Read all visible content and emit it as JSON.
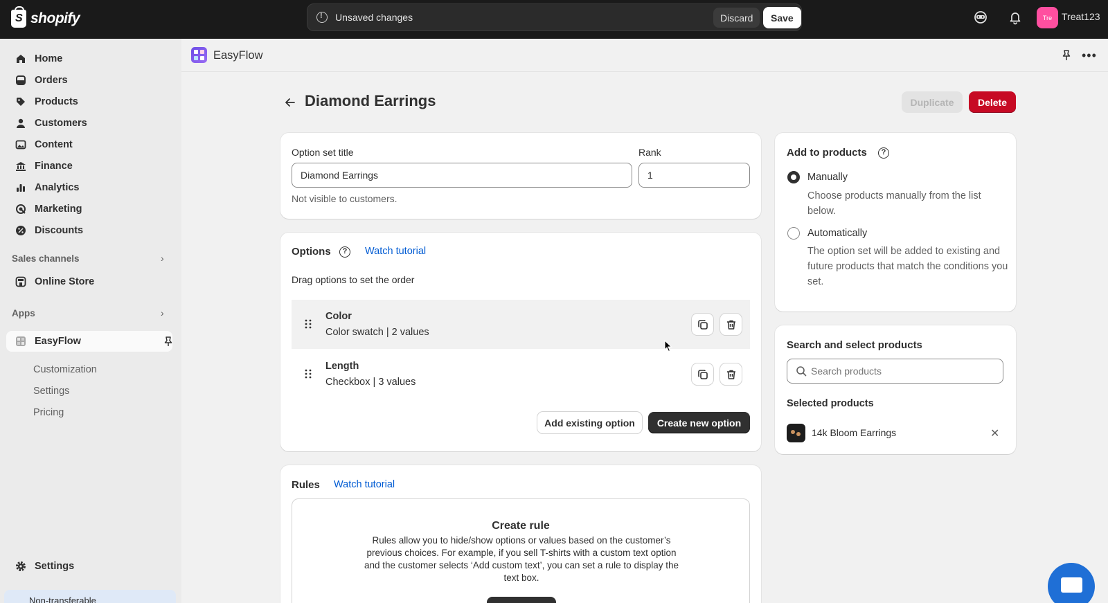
{
  "topbar": {
    "logo_text": "shopify",
    "unsaved_text": "Unsaved changes",
    "discard_label": "Discard",
    "save_label": "Save",
    "avatar_initials": "Tre",
    "store_name": "Treat123"
  },
  "sidebar": {
    "items": [
      {
        "label": "Home",
        "icon": "home-icon"
      },
      {
        "label": "Orders",
        "icon": "orders-icon"
      },
      {
        "label": "Products",
        "icon": "tag-icon"
      },
      {
        "label": "Customers",
        "icon": "person-icon"
      },
      {
        "label": "Content",
        "icon": "image-icon"
      },
      {
        "label": "Finance",
        "icon": "bank-icon"
      },
      {
        "label": "Analytics",
        "icon": "bar-chart-icon"
      },
      {
        "label": "Marketing",
        "icon": "target-icon"
      },
      {
        "label": "Discounts",
        "icon": "discount-icon"
      }
    ],
    "sales_channels_label": "Sales channels",
    "online_store_label": "Online Store",
    "apps_label": "Apps",
    "app_name": "EasyFlow",
    "app_sub_items": [
      "Customization",
      "Settings",
      "Pricing"
    ],
    "settings_label": "Settings",
    "non_transferable_label": "Non-transferable"
  },
  "appbar": {
    "title": "EasyFlow"
  },
  "page": {
    "title": "Diamond Earrings",
    "duplicate_label": "Duplicate",
    "delete_label": "Delete"
  },
  "option_set": {
    "title_label": "Option set title",
    "title_value": "Diamond Earrings",
    "rank_label": "Rank",
    "rank_value": "1",
    "help_text": "Not visible to customers."
  },
  "options": {
    "heading": "Options",
    "tutorial_link": "Watch tutorial",
    "drag_hint": "Drag options to set the order",
    "rows": [
      {
        "name": "Color",
        "type": "Color swatch",
        "count": "2 values"
      },
      {
        "name": "Length",
        "type": "Checkbox",
        "count": "3 values"
      }
    ],
    "add_existing_label": "Add existing option",
    "create_new_label": "Create new option"
  },
  "rules": {
    "heading": "Rules",
    "tutorial_link": "Watch tutorial",
    "create_title": "Create rule",
    "create_text": "Rules allow you to hide/show options or values based on the customer’s previous choices. For example, if you sell T-shirts with a custom text option and the customer selects ‘Add custom text’, you can set a rule to display the text box."
  },
  "add_to_products": {
    "heading": "Add to products",
    "manual_label": "Manually",
    "manual_help": "Choose products manually from the list below.",
    "auto_label": "Automatically",
    "auto_help": "The option set will be added to existing and future products that match the conditions you set.",
    "selected": "manual"
  },
  "product_search": {
    "heading": "Search and select products",
    "placeholder": "Search products",
    "selected_heading": "Selected products",
    "selected_products": [
      {
        "name": "14k Bloom Earrings"
      }
    ]
  },
  "colors": {
    "delete": "#c70a24",
    "link": "#005bd3",
    "primary": "#303030",
    "avatar": "#ff4fa0"
  }
}
